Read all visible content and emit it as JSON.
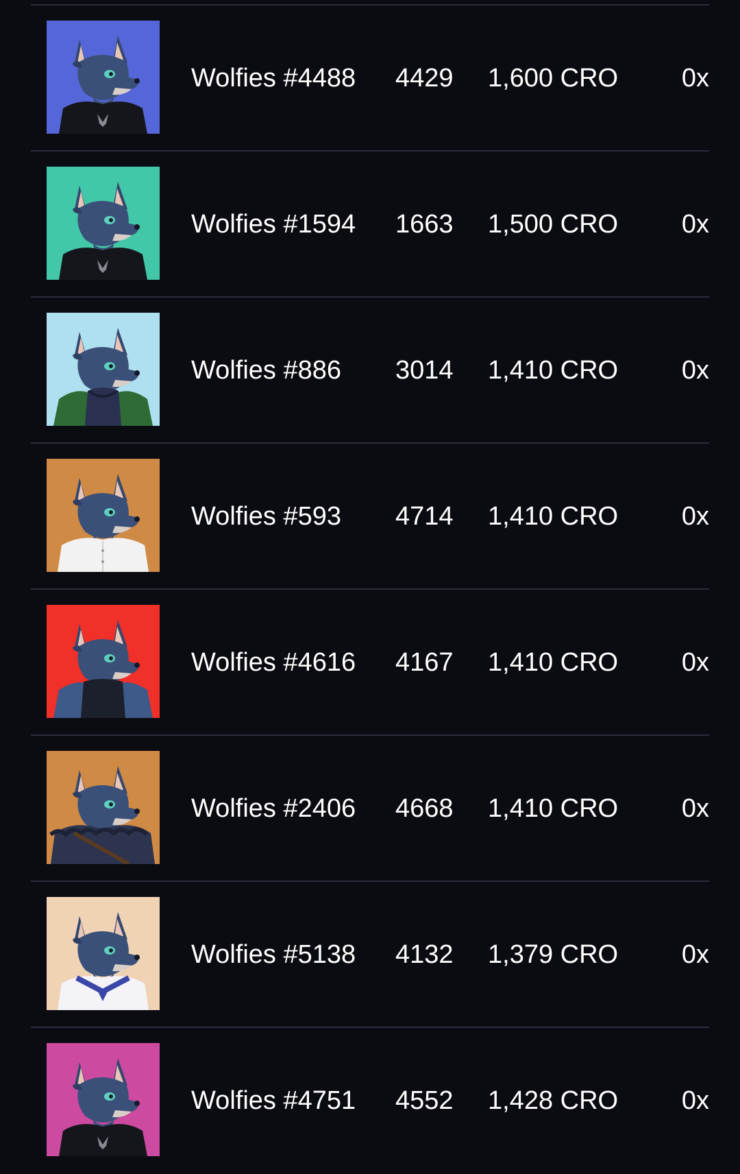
{
  "listings": [
    {
      "name": "Wolfies #4488",
      "rank": "4429",
      "price": "1,600 CRO",
      "address": "0x",
      "bg": "#5566d8",
      "outfit": "tee"
    },
    {
      "name": "Wolfies #1594",
      "rank": "1663",
      "price": "1,500 CRO",
      "address": "0x",
      "bg": "#42c7a8",
      "outfit": "tee"
    },
    {
      "name": "Wolfies #886",
      "rank": "3014",
      "price": "1,410 CRO",
      "address": "0x",
      "bg": "#aee0f0",
      "outfit": "hoodie"
    },
    {
      "name": "Wolfies #593",
      "rank": "4714",
      "price": "1,410 CRO",
      "address": "0x",
      "bg": "#cf8a45",
      "outfit": "shirt"
    },
    {
      "name": "Wolfies #4616",
      "rank": "4167",
      "price": "1,410 CRO",
      "address": "0x",
      "bg": "#f2302a",
      "outfit": "vest"
    },
    {
      "name": "Wolfies #2406",
      "rank": "4668",
      "price": "1,410 CRO",
      "address": "0x",
      "bg": "#cf8a45",
      "outfit": "fur"
    },
    {
      "name": "Wolfies #5138",
      "rank": "4132",
      "price": "1,379 CRO",
      "address": "0x",
      "bg": "#f0d2b5",
      "outfit": "sailor"
    },
    {
      "name": "Wolfies #4751",
      "rank": "4552",
      "price": "1,428 CRO",
      "address": "0x",
      "bg": "#cc4aa0",
      "outfit": "tee"
    }
  ]
}
